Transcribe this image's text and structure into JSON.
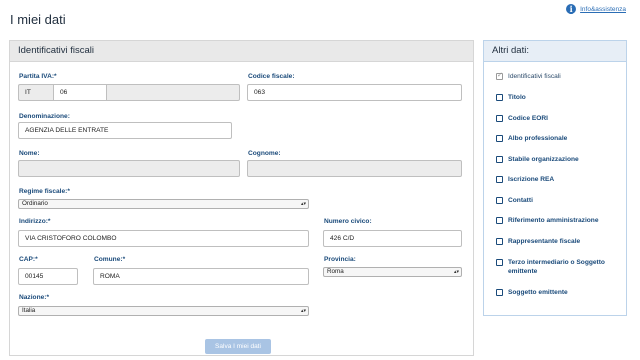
{
  "page": {
    "title": "I miei dati",
    "help_label": "Info&assistenza",
    "help_icon": "info-icon"
  },
  "form": {
    "title": "Identificativi fiscali",
    "partita_iva": {
      "label": "Partita IVA:*",
      "country": "IT",
      "value": "06"
    },
    "codice_fiscale": {
      "label": "Codice fiscale:",
      "value": "063"
    },
    "denominazione": {
      "label": "Denominazione:",
      "value": "AGENZIA DELLE ENTRATE"
    },
    "nome": {
      "label": "Nome:",
      "value": ""
    },
    "cognome": {
      "label": "Cognome:",
      "value": ""
    },
    "regime_fiscale": {
      "label": "Regime fiscale:*",
      "value": "Ordinario"
    },
    "indirizzo": {
      "label": "Indirizzo:*",
      "value": "VIA CRISTOFORO COLOMBO"
    },
    "numero_civico": {
      "label": "Numero civico:",
      "value": "426 C/D"
    },
    "cap": {
      "label": "CAP:*",
      "value": "00145"
    },
    "comune": {
      "label": "Comune:*",
      "value": "ROMA"
    },
    "provincia": {
      "label": "Provincia:",
      "value": "Roma"
    },
    "nazione": {
      "label": "Nazione:*",
      "value": "Italia"
    },
    "save_label": "Salva I miei dati"
  },
  "sidebar": {
    "title": "Altri dati:",
    "items": [
      {
        "label": "Identificativi fiscali",
        "checked": true
      },
      {
        "label": "Titolo",
        "checked": false
      },
      {
        "label": "Codice EORI",
        "checked": false
      },
      {
        "label": "Albo professionale",
        "checked": false
      },
      {
        "label": "Stabile organizzazione",
        "checked": false
      },
      {
        "label": "Iscrizione REA",
        "checked": false
      },
      {
        "label": "Contatti",
        "checked": false
      },
      {
        "label": "Riferimento amministrazione",
        "checked": false
      },
      {
        "label": "Rappresentante fiscale",
        "checked": false
      },
      {
        "label": "Terzo intermediario o Soggetto emittente",
        "checked": false
      },
      {
        "label": "Soggetto emittente",
        "checked": false
      }
    ]
  }
}
